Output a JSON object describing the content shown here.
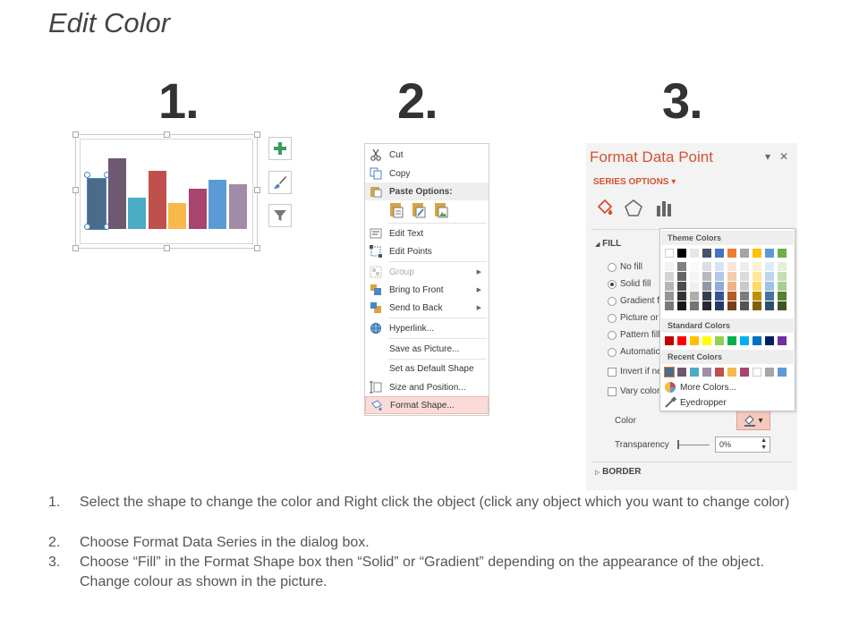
{
  "title": "Edit Color",
  "steps": [
    "1.",
    "2.",
    "3."
  ],
  "chart": {
    "bar_colors": [
      "#4a6b8a",
      "#6f5872",
      "#4bacc6",
      "#c0504d",
      "#f6b94a",
      "#a9436f",
      "#5b9bd5",
      "#a08ca8"
    ],
    "bar_values": [
      0.56,
      0.79,
      0.35,
      0.65,
      0.29,
      0.45,
      0.55,
      0.5
    ],
    "buttons": [
      "plus-icon",
      "brush-icon",
      "filter-icon"
    ]
  },
  "context_menu": {
    "items": [
      {
        "label": "Cut",
        "icon": "scissors-icon"
      },
      {
        "label": "Copy",
        "icon": "copy-icon"
      },
      {
        "label": "Paste Options:",
        "icon": "paste-icon"
      },
      {
        "label": "Edit Text",
        "icon": "edit-text-icon"
      },
      {
        "label": "Edit Points",
        "icon": "edit-points-icon"
      },
      {
        "label": "Group",
        "icon": "group-icon"
      },
      {
        "label": "Bring to Front",
        "icon": "bring-front-icon"
      },
      {
        "label": "Send to Back",
        "icon": "send-back-icon"
      },
      {
        "label": "Hyperlink...",
        "icon": "hyperlink-icon"
      },
      {
        "label": "Save as Picture...",
        "icon": ""
      },
      {
        "label": "Set as Default Shape",
        "icon": ""
      },
      {
        "label": "Size and Position...",
        "icon": "size-position-icon"
      },
      {
        "label": "Format Shape...",
        "icon": "format-shape-icon"
      }
    ]
  },
  "format_pane": {
    "title": "Format Data Point",
    "close_glyph": "✕",
    "pin_glyph": "▾",
    "series_options": "SERIES OPTIONS",
    "fill_section": "FILL",
    "options": [
      "No fill",
      "Solid fill",
      "Gradient fill",
      "Picture or texture fill",
      "Pattern fill",
      "Automatic"
    ],
    "checkboxes": [
      "Invert if negative",
      "Vary colors by point"
    ],
    "color_label": "Color",
    "transparency_label": "Transparency",
    "transparency_value": "0%",
    "border_section": "BORDER"
  },
  "color_dropdown": {
    "theme_colors_label": "Theme Colors",
    "standard_colors_label": "Standard Colors",
    "recent_colors_label": "Recent Colors",
    "more_colors": "More Colors...",
    "eyedropper": "Eyedropper",
    "theme_top": [
      "#ffffff",
      "#000000",
      "#e7e6e6",
      "#44546a",
      "#4472c4",
      "#ed7d31",
      "#a5a5a5",
      "#ffc000",
      "#5b9bd5",
      "#70ad47"
    ],
    "standard": [
      "#c00000",
      "#ff0000",
      "#ffc000",
      "#ffff00",
      "#92d050",
      "#00b050",
      "#00b0f0",
      "#0070c0",
      "#002060",
      "#7030a0"
    ],
    "recent": [
      "#4a6b8a",
      "#6f5872",
      "#4bacc6",
      "#a08ca8",
      "#c0504d",
      "#f6b94a",
      "#a9436f",
      "#ffffff",
      "#a5a5a5",
      "#5b9bd5"
    ]
  },
  "instructions": [
    {
      "num": "1.",
      "text": "Select the shape to change the color and Right click the object (click any object which you want to change color)"
    },
    {
      "num": "2.",
      "text": "Choose Format Data Series in the dialog box."
    },
    {
      "num": "3.",
      "text": "Choose “Fill” in the Format Shape box then “Solid” or “Gradient” depending on the appearance of the object. Change colour as shown in the picture."
    }
  ]
}
